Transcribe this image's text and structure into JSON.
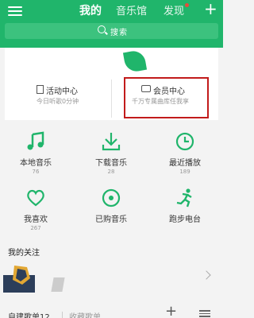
{
  "header": {
    "tabs": [
      {
        "label": "我的",
        "active": true
      },
      {
        "label": "音乐馆",
        "active": false
      },
      {
        "label": "发现",
        "active": false
      }
    ],
    "search_placeholder": "搜索",
    "colors": {
      "brand": "#20b56b",
      "badge": "#e64b3c"
    }
  },
  "cards": [
    {
      "title": "活动中心",
      "subtitle": "今日听歌0分钟",
      "icon": "flag-icon"
    },
    {
      "title": "会员中心",
      "subtitle": "千万专属曲库任我享",
      "icon": "vip-diamond-icon"
    }
  ],
  "grid": [
    {
      "label": "本地音乐",
      "count": "76",
      "icon": "music-note-icon"
    },
    {
      "label": "下载音乐",
      "count": "28",
      "icon": "download-icon"
    },
    {
      "label": "最近播放",
      "count": "189",
      "icon": "clock-icon"
    },
    {
      "label": "我喜欢",
      "count": "267",
      "icon": "heart-icon"
    },
    {
      "label": "已购音乐",
      "count": "",
      "icon": "disc-icon"
    },
    {
      "label": "跑步电台",
      "count": "",
      "icon": "running-icon"
    }
  ],
  "following": {
    "title": "我的关注"
  },
  "playlists": {
    "tabs": [
      "自建歌单12",
      "收藏歌单"
    ]
  }
}
